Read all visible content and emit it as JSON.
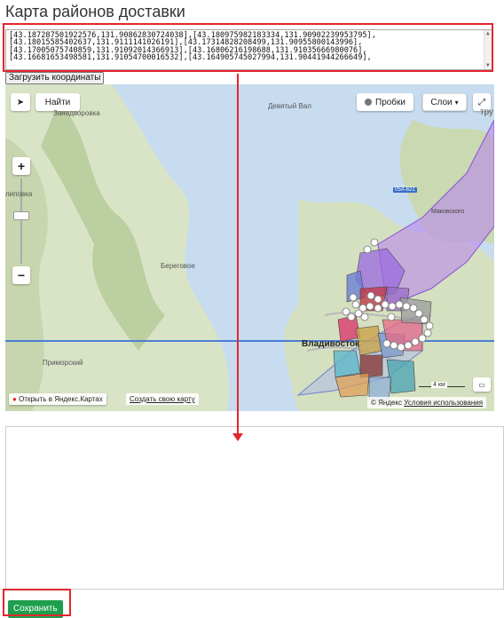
{
  "page": {
    "title": "Карта районов доставки"
  },
  "coordinates": {
    "lines": [
      "[43.187287501922576,131.90862830724038],[43.180975982183334,131.90902239953795],",
      "[43.18015585402637,131.9111141026191],[43.17314828208499,131.90955800143996],",
      "[43.17005075740859,131.91092014366913],[43.16806216198688,131.91035666980076],",
      "[43.16681653498581,131.91054700016532],[43.164905745027994,131.90441944266649],"
    ]
  },
  "buttons": {
    "load_coords": "Загрузить координаты",
    "save": "Сохранить"
  },
  "map": {
    "find": "Найти",
    "traffic": "Пробки",
    "layers": "Слои",
    "zoom_in": "+",
    "zoom_out": "−",
    "labels": {
      "zavodrovka": "Занадворовка",
      "devyatyi_val": "Девятый Вал",
      "tru": "тру",
      "lipovka": "липовка",
      "beregovoe": "Береговое",
      "primorsky": "Приморский",
      "vladivostok": "Владивосток",
      "makovskogo": "Маковского",
      "road_sign": "05А-621"
    },
    "scale": "4 км",
    "open_yandex": "Открыть в Яндекс.Картах",
    "create_map": "Создать свою карту",
    "copyright": "© Яндекс",
    "terms": "Условия использования"
  },
  "colors": {
    "accent_red": "#e3262d",
    "save_green": "#1e9f4d",
    "purple_zone": "#b67ff0"
  },
  "icons": [
    "locate-arrow-icon",
    "traffic-icon",
    "chevron-down-icon",
    "fullscreen-icon",
    "pin-icon",
    "ruler-icon"
  ]
}
